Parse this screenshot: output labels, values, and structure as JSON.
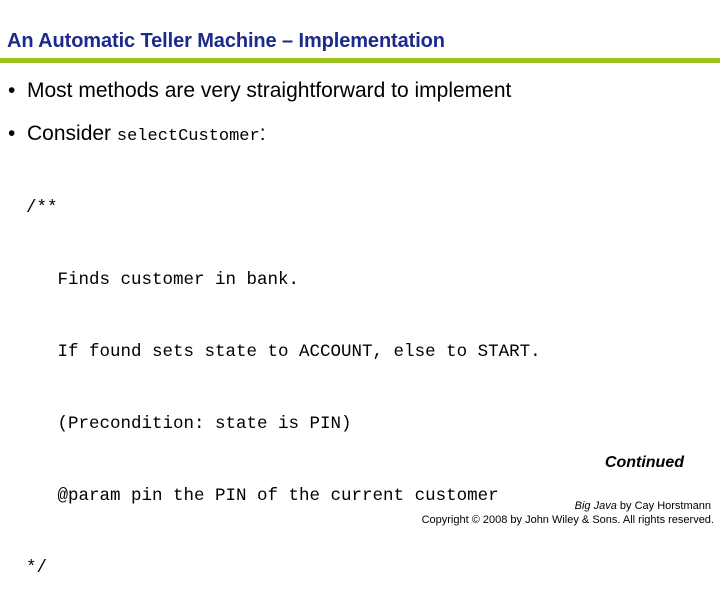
{
  "title": "An Automatic Teller Machine – Implementation",
  "accent_colors": {
    "title": "#1c2a8c",
    "rule": "#99c21f"
  },
  "bullets": [
    {
      "marker": "•",
      "text": "Most methods are very straightforward to implement"
    },
    {
      "marker": "•",
      "text": "Consider ",
      "code": "selectCustomer",
      "suffix": ":"
    }
  ],
  "code_lines": [
    "/**",
    "   Finds customer in bank.",
    "   If found sets state to ACCOUNT, else to START.",
    "   (Precondition: state is PIN)",
    "   @param pin the PIN of the current customer",
    "*/"
  ],
  "continued_label": "Continued",
  "footer": {
    "book_title": "Big Java",
    "book_author": " by Cay Horstmann",
    "copyright": "Copyright © 2008 by John Wiley & Sons.  All rights reserved."
  }
}
